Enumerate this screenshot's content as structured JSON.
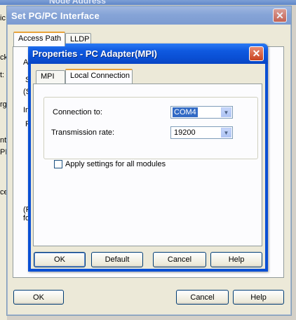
{
  "background": {
    "title_fragment": "Node Address",
    "left_fragments": [
      "ic",
      "ck",
      "t:",
      "rg",
      "nt",
      "PI",
      "ce"
    ]
  },
  "outer_dialog": {
    "title": "Set PG/PC Interface",
    "tabs": [
      {
        "label": "Access Path",
        "active": true
      },
      {
        "label": "LLDP",
        "active": false
      }
    ],
    "panel_fragments": [
      "A",
      "S",
      "(S",
      "In",
      "P",
      "(R",
      "fo"
    ],
    "buttons": {
      "ok": "OK",
      "cancel": "Cancel",
      "help": "Help"
    }
  },
  "properties_dialog": {
    "title": "Properties - PC Adapter(MPI)",
    "tabs": [
      {
        "label": "MPI",
        "active": false
      },
      {
        "label": "Local Connection",
        "active": true
      }
    ],
    "connection_to": {
      "label": "Connection to:",
      "value": "COM4"
    },
    "transmission_rate": {
      "label": "Transmission rate:",
      "value": "19200"
    },
    "apply_all_modules": {
      "label": "Apply settings for all modules",
      "checked": false
    },
    "buttons": {
      "ok": "OK",
      "default": "Default",
      "cancel": "Cancel",
      "help": "Help"
    }
  },
  "colors": {
    "title_active": "#0a4fd4",
    "title_inactive": "#86a4d7",
    "selection": "#316ac5",
    "tab_highlight": "#e8a33a"
  },
  "icons": [
    "close-icon",
    "dropdown-arrow-icon"
  ]
}
